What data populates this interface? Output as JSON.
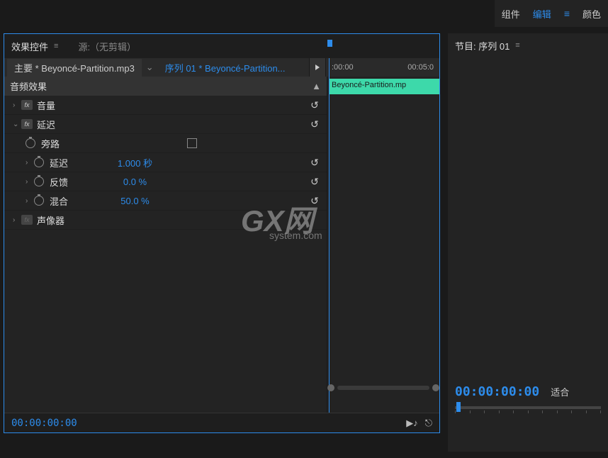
{
  "top_tabs": {
    "components": "组件",
    "edit": "编辑",
    "color": "颜色"
  },
  "panel": {
    "title": "效果控件",
    "source_label": "源:（无剪辑）",
    "master_clip": "主要 * Beyoncé-Partition.mp3",
    "sequence_clip": "序列 01 * Beyoncé-Partition...",
    "timecode": "00:00:00:00"
  },
  "timeline": {
    "start": ":00:00",
    "end": "00:05:0",
    "clip_label": "Beyoncé-Partition.mp"
  },
  "sections": {
    "audio_effects": "音频效果"
  },
  "effects": {
    "volume": {
      "label": "音量"
    },
    "delay": {
      "label": "延迟",
      "bypass": {
        "label": "旁路"
      },
      "delay_param": {
        "label": "延迟",
        "value": "1.000 秒"
      },
      "feedback": {
        "label": "反馈",
        "value": "0.0 %"
      },
      "mix": {
        "label": "混合",
        "value": "50.0 %"
      }
    },
    "panner": {
      "label": "声像器"
    }
  },
  "right_panel": {
    "title": "节目: 序列 01",
    "timecode": "00:00:00:00",
    "fit": "适合"
  },
  "watermark": {
    "main": "GX网",
    "sub": "system.com"
  }
}
